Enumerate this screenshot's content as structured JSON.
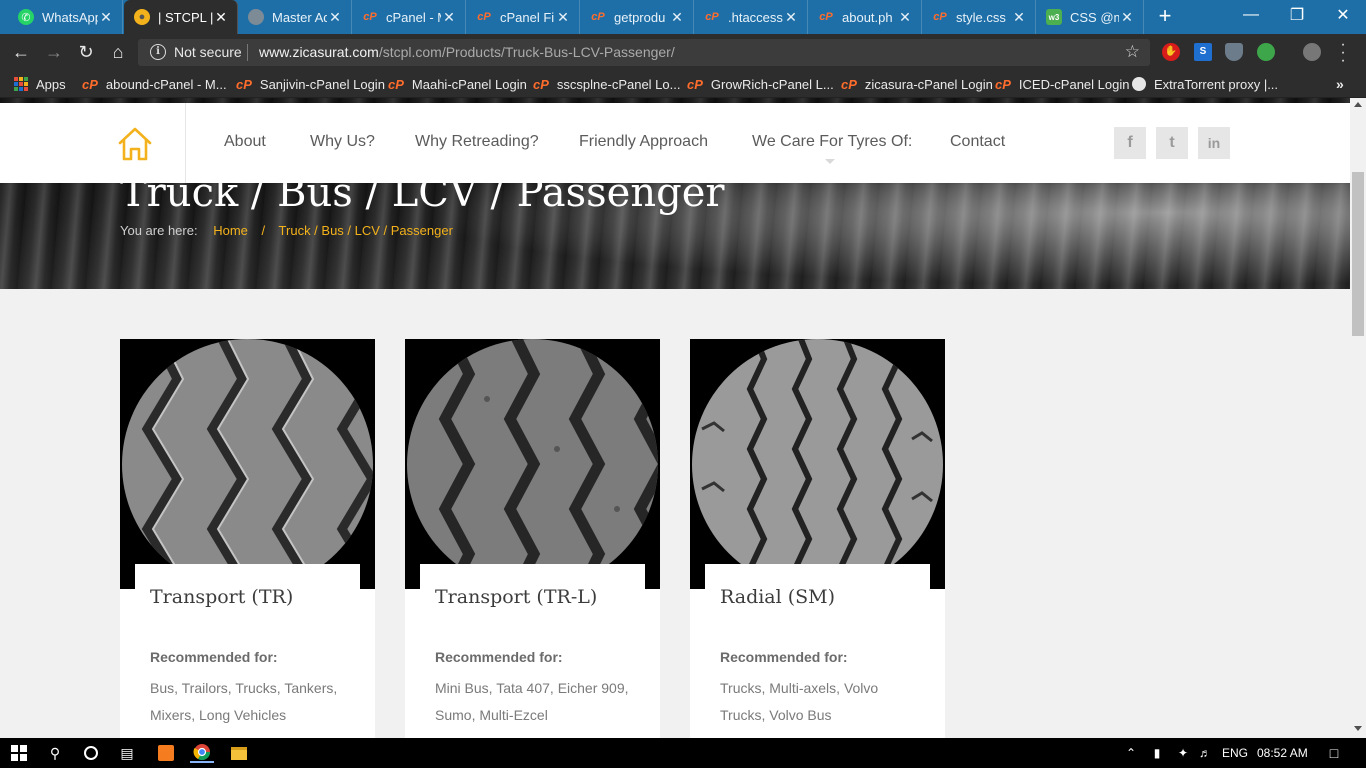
{
  "browser": {
    "tabs": [
      {
        "title": "WhatsApp",
        "icon": "whatsapp-icon",
        "active": false
      },
      {
        "title": "| STCPL |",
        "icon": "stcpl-favicon",
        "active": true
      },
      {
        "title": "Master Ad",
        "icon": "globe-icon",
        "active": false
      },
      {
        "title": "cPanel - M",
        "icon": "cpanel-icon",
        "active": false
      },
      {
        "title": "cPanel Fi",
        "icon": "cpanel-icon",
        "active": false
      },
      {
        "title": "getprodu",
        "icon": "cpanel-icon",
        "active": false
      },
      {
        "title": ".htaccess",
        "icon": "cpanel-icon",
        "active": false
      },
      {
        "title": "about.ph",
        "icon": "cpanel-icon",
        "active": false
      },
      {
        "title": "style.css",
        "icon": "cpanel-icon",
        "active": false
      },
      {
        "title": "CSS @m",
        "icon": "w3schools-icon",
        "active": false
      }
    ],
    "tab_close": "✕",
    "new_tab": "+",
    "security_label": "Not secure",
    "url_host": "www.zicasurat.com",
    "url_path": "/stcpl.com/Products/Truck-Bus-LCV-Passenger/",
    "bookmarks": [
      {
        "label": "Apps",
        "icon": "apps-grid-icon"
      },
      {
        "label": "abound-cPanel - M...",
        "icon": "cpanel-icon"
      },
      {
        "label": "Sanjivin-cPanel Login",
        "icon": "cpanel-icon"
      },
      {
        "label": "Maahi-cPanel Login",
        "icon": "cpanel-icon"
      },
      {
        "label": "sscsplne-cPanel Lo...",
        "icon": "cpanel-icon"
      },
      {
        "label": "GrowRich-cPanel L...",
        "icon": "cpanel-icon"
      },
      {
        "label": "zicasura-cPanel Login",
        "icon": "cpanel-icon"
      },
      {
        "label": "ICED-cPanel Login",
        "icon": "cpanel-icon"
      },
      {
        "label": "ExtraTorrent proxy |...",
        "icon": "globe-icon"
      }
    ],
    "bookmarks_more": "»"
  },
  "site": {
    "nav": [
      {
        "label": "About"
      },
      {
        "label": "Why Us?"
      },
      {
        "label": "Why Retreading?"
      },
      {
        "label": "Friendly Approach"
      },
      {
        "label": "We Care For Tyres Of:"
      },
      {
        "label": "Contact"
      }
    ],
    "social": [
      {
        "icon": "facebook-icon",
        "glyph": "f"
      },
      {
        "icon": "twitter-icon",
        "glyph": "t"
      },
      {
        "icon": "linkedin-icon",
        "glyph": "in"
      }
    ],
    "hero_title": "Truck / Bus / LCV / Passenger",
    "breadcrumb_label": "You are here:",
    "breadcrumb": [
      "Home",
      "Truck / Bus / LCV / Passenger"
    ],
    "accent_color": "#f3b21c",
    "products": [
      {
        "title": "Transport (TR)",
        "label": "Recommended for:",
        "text": "Bus, Trailors, Trucks, Tankers, Mixers, Long Vehicles"
      },
      {
        "title": "Transport (TR-L)",
        "label": "Recommended for:",
        "text": "Mini Bus, Tata 407, Eicher 909, Sumo, Multi-Ezcel"
      },
      {
        "title": "Radial (SM)",
        "label": "Recommended for:",
        "text": "Trucks, Multi-axels, Volvo Trucks, Volvo Bus"
      }
    ]
  },
  "taskbar": {
    "language": "ENG",
    "time": "08:52 AM"
  }
}
